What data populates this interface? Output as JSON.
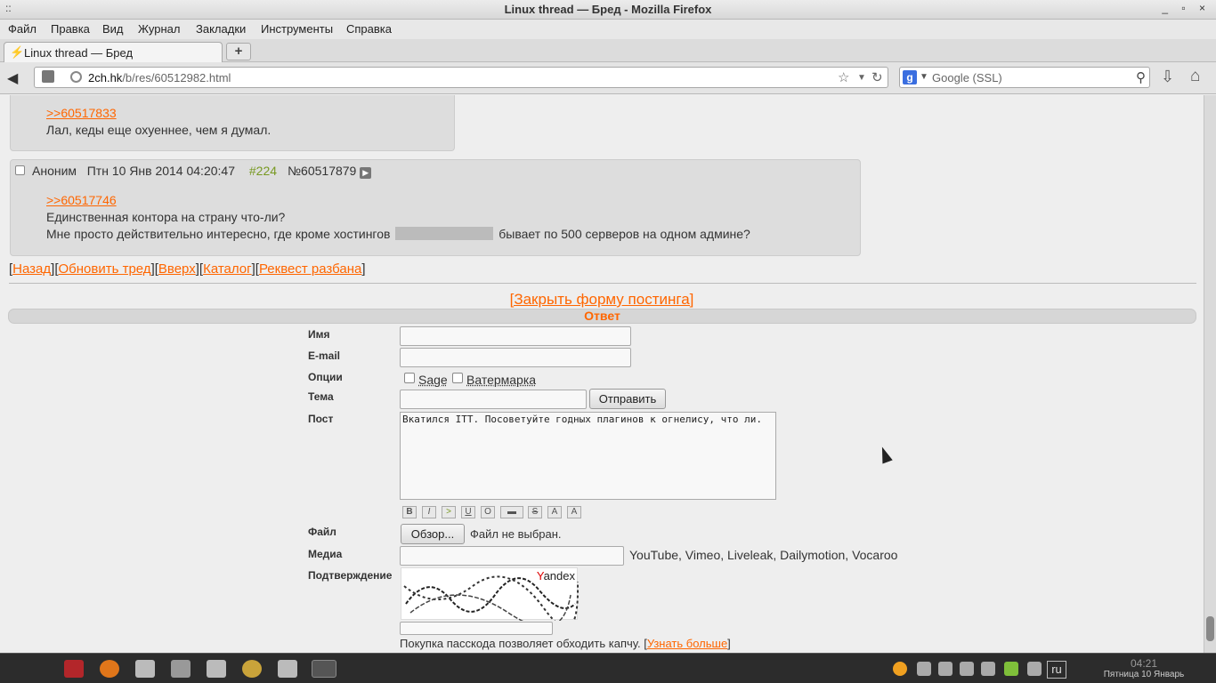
{
  "window": {
    "title": "Linux thread — Бред - Mozilla Firefox",
    "menu_glyph": "::",
    "controls": "_ ▫ ×"
  },
  "menubar": [
    "Файл",
    "Правка",
    "Вид",
    "Журнал",
    "Закладки",
    "Инструменты",
    "Справка"
  ],
  "tab": {
    "label": "Linux thread — Бред",
    "new_tab": "+"
  },
  "navbar": {
    "url_host": "2ch.hk",
    "url_path": "/b/res/60512982.html",
    "search_placeholder": "Google (SSL)",
    "search_engine_letter": "g"
  },
  "posts": [
    {
      "reply_ref": ">>60517833",
      "lines": [
        "Лал, кеды еще охуеннее, чем я думал."
      ]
    },
    {
      "author": "Аноним",
      "date": "Птн 10 Янв 2014 04:20:47",
      "index": "#224",
      "post_no": "№60517879",
      "reply_ref": ">>60517746",
      "line1": "Единственная контора на страну что-ли?",
      "line2_before": "Мне просто действительно интересно, где кроме хостингов",
      "line2_after": "бывает по 500 серверов на одном админе?"
    }
  ],
  "thread_nav": [
    "Назад",
    "Обновить тред",
    "Вверх",
    "Каталог",
    "Реквест разбана"
  ],
  "form": {
    "close_link": "[Закрыть форму постинга]",
    "header": "Ответ",
    "labels": {
      "name": "Имя",
      "email": "E-mail",
      "options": "Опции",
      "subject": "Тема",
      "post": "Пост",
      "file": "Файл",
      "media": "Медиа",
      "confirm": "Подтверждение"
    },
    "sage": "Sage",
    "watermark": "Ватермарка",
    "submit": "Отправить",
    "post_text": "Вкатился ITT. Посоветуйте годных плагинов к огнелису, что ли.",
    "markup_buttons": [
      "B",
      "I",
      ">",
      "U",
      "O",
      "▬",
      "S",
      "A",
      "A"
    ],
    "browse": "Обзор...",
    "file_status": "Файл не выбран.",
    "media_hint": "YouTube, Vimeo, Liveleak, Dailymotion, Vocaroo",
    "captcha_brand_y": "Y",
    "captcha_brand_rest": "andex",
    "passcode_text": "Покупка пасскода позволяет обходить капчу.",
    "passcode_link": "Узнать больше"
  },
  "taskbar": {
    "lang": "ru",
    "time": "04:21",
    "date": "Пятница 10 Январь"
  }
}
